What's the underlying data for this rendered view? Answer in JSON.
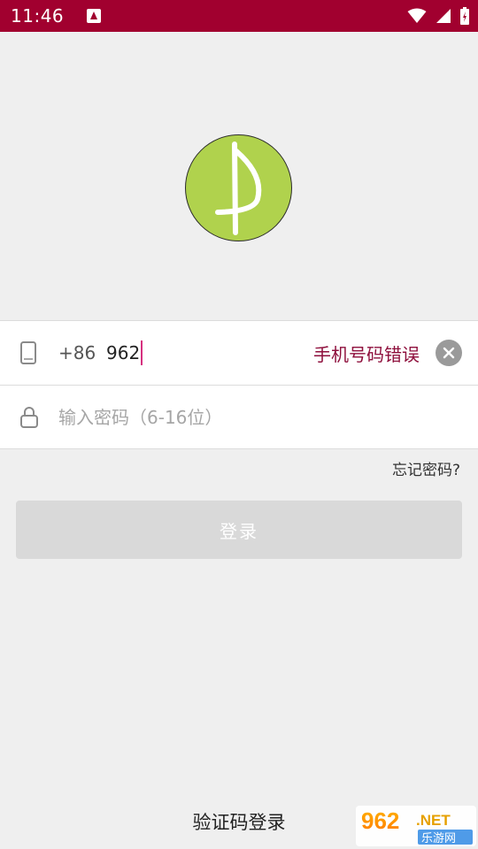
{
  "status_bar": {
    "time": "11:46"
  },
  "login_form": {
    "country_code": "+86",
    "phone_value": "962",
    "phone_error": "手机号码错误",
    "password_placeholder": "输入密码（6-16位）",
    "password_value": ""
  },
  "forgot_password": "忘记密码?",
  "login_button": "登录",
  "sms_login": "验证码登录",
  "watermark": {
    "brand": "962.NET",
    "site": "乐游网"
  },
  "colors": {
    "status_bar": "#a1002f",
    "logo_green": "#b0d24d",
    "error_text": "#8e0f3c",
    "caret": "#d6307f",
    "button_disabled": "#d9d9d9"
  },
  "icons": [
    "notification-icon",
    "wifi-icon",
    "signal-icon",
    "battery-icon",
    "phone-icon",
    "lock-icon",
    "clear-icon"
  ]
}
